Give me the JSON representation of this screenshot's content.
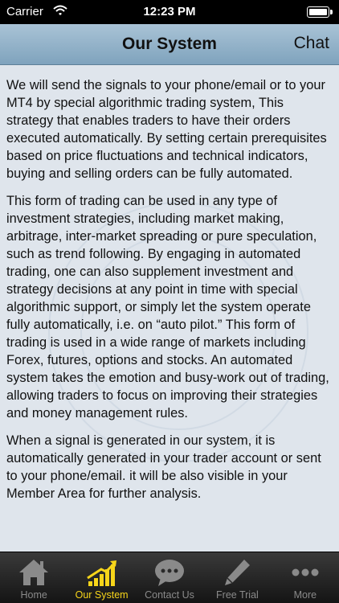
{
  "status_bar": {
    "carrier": "Carrier",
    "time": "12:23 PM"
  },
  "nav": {
    "title": "Our System",
    "chat_label": "Chat"
  },
  "content": {
    "paragraphs": [
      "We will send the signals to your phone/email or to your MT4 by special algorithmic trading system, This strategy that enables traders to have their orders executed automatically. By setting certain prerequisites based on price fluctuations and technical indicators, buying and selling orders can be fully automated.",
      "This form of trading can be used in any type of investment strategies, including market making, arbitrage, inter-market spreading or pure speculation, such as trend following. By engaging in automated trading, one can also supplement investment and strategy decisions at any point in time with special algorithmic support, or simply let the system operate fully automatically, i.e. on “auto pilot.” This form of trading is used in a wide range of markets including Forex, futures, options and stocks. An automated system takes the emotion and busy-work out of trading, allowing traders to focus on improving their strategies and money management rules.",
      "When a signal is generated in our system, it is automatically generated in your trader account or sent to your phone/email. it will be also visible in your Member Area for further analysis."
    ]
  },
  "tabs": [
    {
      "label": "Home",
      "icon": "home-icon",
      "active": false
    },
    {
      "label": "Our System",
      "icon": "chart-icon",
      "active": true
    },
    {
      "label": "Contact Us",
      "icon": "speech-bubble-icon",
      "active": false
    },
    {
      "label": "Free Trial",
      "icon": "pen-icon",
      "active": false
    },
    {
      "label": "More",
      "icon": "more-dots-icon",
      "active": false
    }
  ],
  "colors": {
    "active_tab": "#f7d51a",
    "inactive_tab": "#8a8a8a",
    "nav_bar": "#8fb0c8",
    "background": "#dfe5ec"
  }
}
